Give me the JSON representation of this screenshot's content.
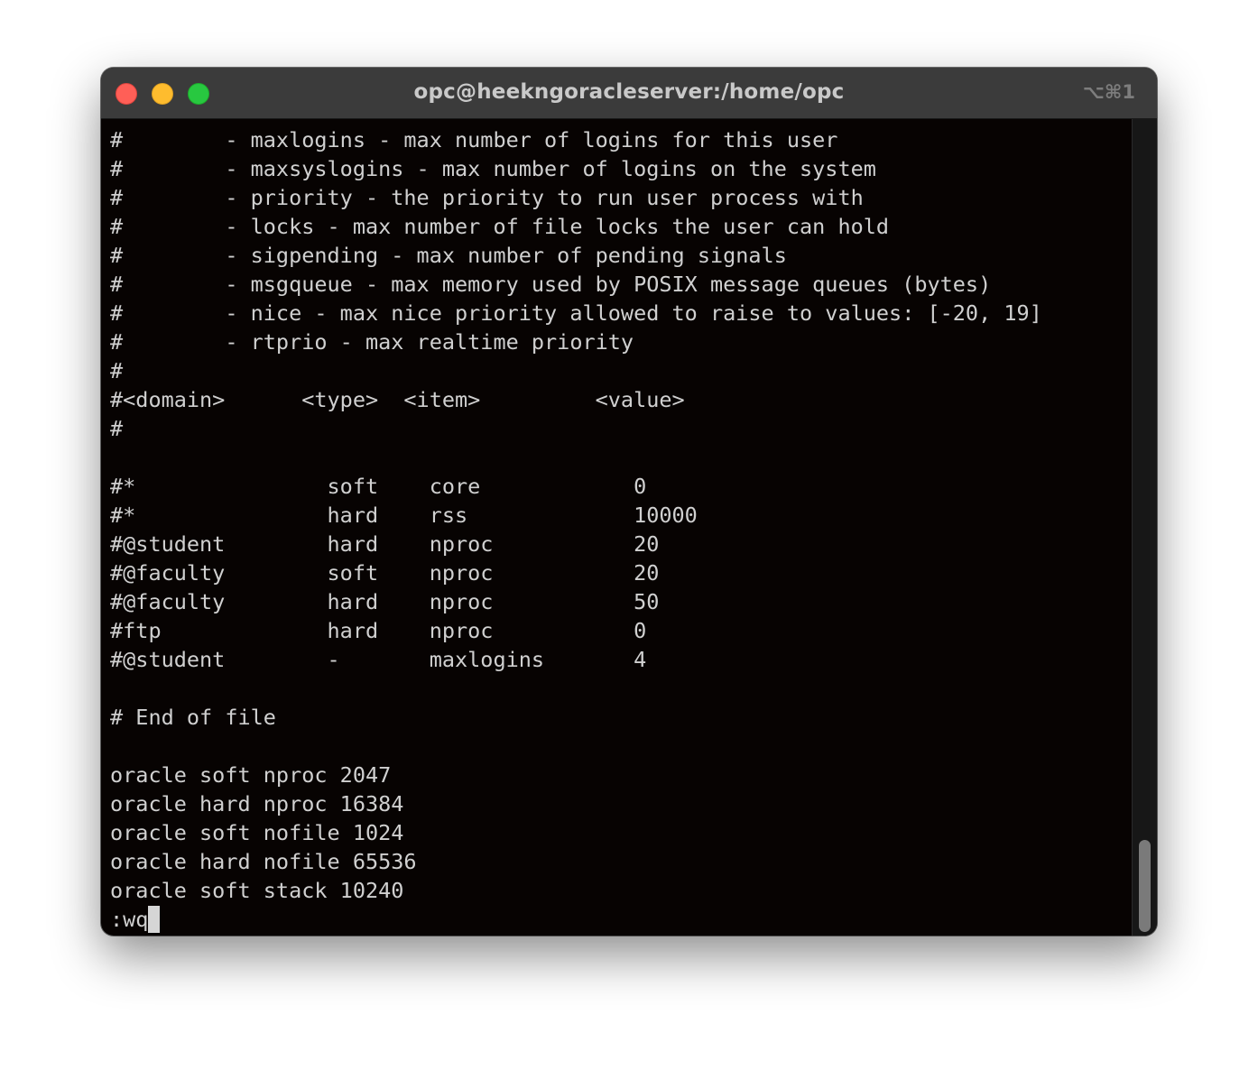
{
  "window": {
    "title": "opc@heekngoracleserver:/home/opc",
    "shortcut": "⌥⌘1",
    "buttons": {
      "close": "close-button",
      "minimize": "minimize-button",
      "zoom": "zoom-button"
    }
  },
  "terminal": {
    "lines": [
      "#        - maxlogins - max number of logins for this user",
      "#        - maxsyslogins - max number of logins on the system",
      "#        - priority - the priority to run user process with",
      "#        - locks - max number of file locks the user can hold",
      "#        - sigpending - max number of pending signals",
      "#        - msgqueue - max memory used by POSIX message queues (bytes)",
      "#        - nice - max nice priority allowed to raise to values: [-20, 19]",
      "#        - rtprio - max realtime priority",
      "#",
      "#<domain>      <type>  <item>         <value>",
      "#",
      "",
      "#*               soft    core            0",
      "#*               hard    rss             10000",
      "#@student        hard    nproc           20",
      "#@faculty        soft    nproc           20",
      "#@faculty        hard    nproc           50",
      "#ftp             hard    nproc           0",
      "#@student        -       maxlogins       4",
      "",
      "# End of file",
      "",
      "oracle soft nproc 2047",
      "oracle hard nproc 16384",
      "oracle soft nofile 1024",
      "oracle hard nofile 65536",
      "oracle soft stack 10240"
    ],
    "command": ":wq"
  },
  "colors": {
    "background": "#070302",
    "foreground": "#d0d0d0",
    "titlebar": "#3b3b3b"
  }
}
